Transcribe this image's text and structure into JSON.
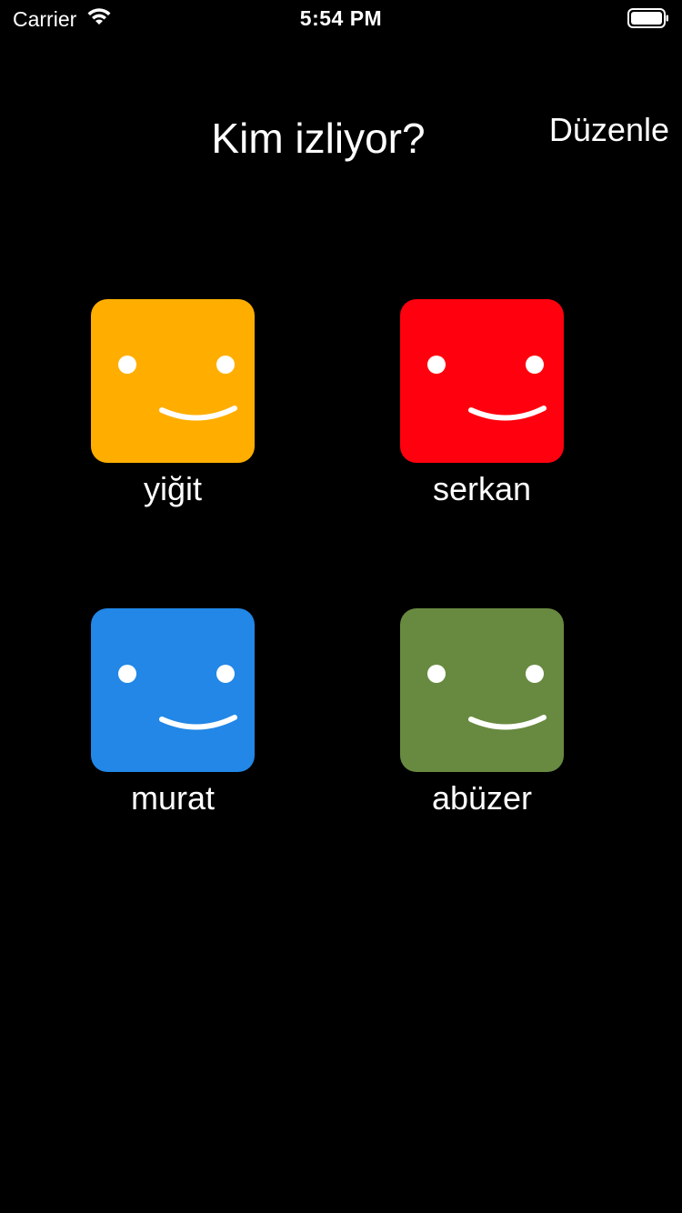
{
  "status_bar": {
    "carrier": "Carrier",
    "time": "5:54 PM",
    "wifi_icon": "wifi-icon",
    "battery_icon": "battery-full-icon"
  },
  "header": {
    "title": "Kim izliyor?",
    "edit_label": "Düzenle"
  },
  "profiles": [
    {
      "name": "yiğit",
      "color": "#FFAE00",
      "icon": "smiley-face-icon"
    },
    {
      "name": "serkan",
      "color": "#FF000E",
      "icon": "smiley-face-icon"
    },
    {
      "name": "murat",
      "color": "#2287E6",
      "icon": "smiley-face-icon"
    },
    {
      "name": "abüzer",
      "color": "#688A40",
      "icon": "smiley-face-icon"
    }
  ]
}
